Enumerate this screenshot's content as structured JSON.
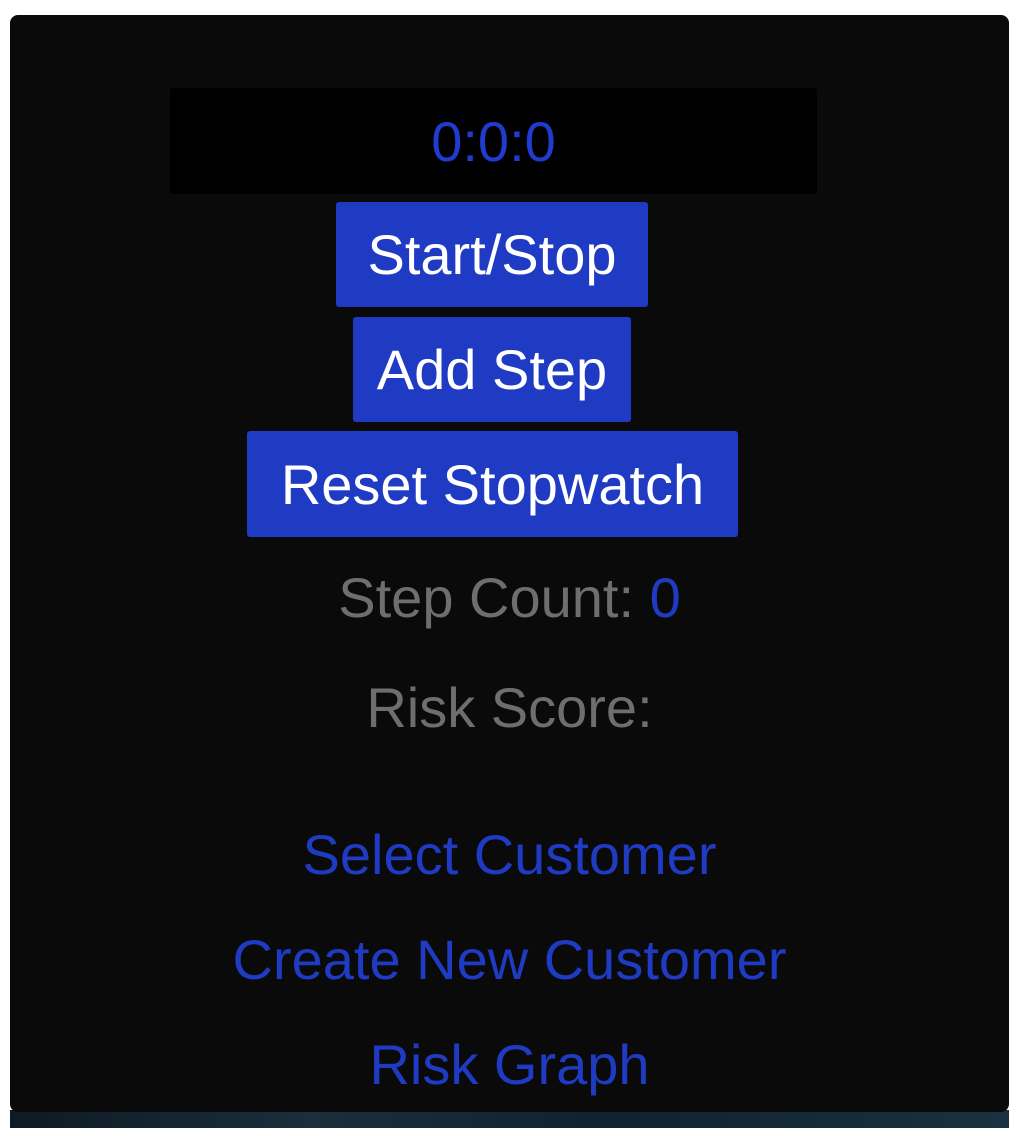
{
  "stopwatch": {
    "display": "0:0:0"
  },
  "buttons": {
    "start_stop": "Start/Stop",
    "add_step": "Add Step",
    "reset": "Reset Stopwatch"
  },
  "stats": {
    "step_count_label": "Step Count:",
    "step_count_value": "0",
    "risk_score_label": "Risk Score:",
    "risk_score_value": ""
  },
  "links": {
    "select_customer": "Select Customer",
    "create_customer": "Create New Customer",
    "risk_graph": "Risk Graph"
  },
  "colors": {
    "accent": "#1f3bc4",
    "panel_bg": "#0a0a0a",
    "muted_text": "#6e6e6e"
  }
}
